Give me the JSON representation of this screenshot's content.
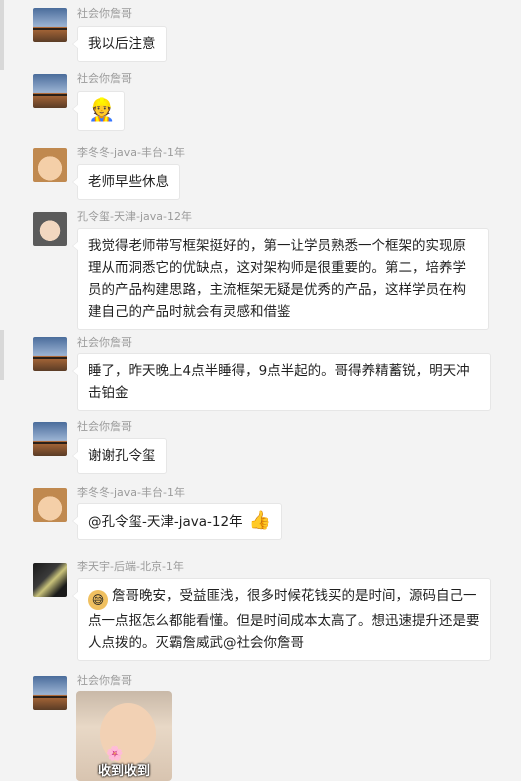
{
  "messages": [
    {
      "sender": "社会你詹哥",
      "text": "我以后注意"
    },
    {
      "sender": "社会你詹哥",
      "emoji": "👷"
    },
    {
      "sender": "李冬冬-java-丰台-1年",
      "text": "老师早些休息"
    },
    {
      "sender": "孔令玺-天津-java-12年",
      "text": "我觉得老师带写框架挺好的，第一让学员熟悉一个框架的实现原理从而洞悉它的优缺点，这对架构师是很重要的。第二，培养学员的产品构建思路，主流框架无疑是优秀的产品，这样学员在构建自己的产品时就会有灵感和借鉴"
    },
    {
      "sender": "社会你詹哥",
      "text": "睡了，昨天晚上4点半睡得，9点半起的。哥得养精蓄锐，明天冲击铂金"
    },
    {
      "sender": "社会你詹哥",
      "text": "谢谢孔令玺"
    },
    {
      "sender": "李冬冬-java-丰台-1年",
      "text": "@孔令玺-天津-java-12年",
      "emoji": "👍"
    },
    {
      "sender": "李天宇-后端-北京-1年",
      "emoji": "😅",
      "text": "詹哥晚安，受益匪浅，很多时候花钱买的是时间，源码自己一点一点抠怎么都能看懂。但是时间成本太高了。想迅速提升还是要人点拨的。灭霸詹威武@社会你詹哥"
    },
    {
      "sender": "社会你詹哥",
      "image_caption": "收到收到"
    }
  ]
}
